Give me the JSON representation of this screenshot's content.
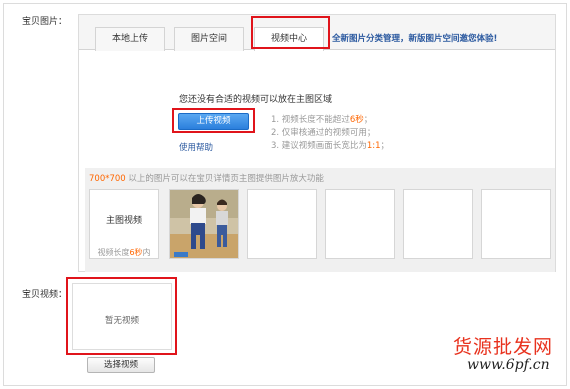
{
  "labels": {
    "images": "宝贝图片：",
    "video": "宝贝视频："
  },
  "tabs": [
    {
      "label": "本地上传",
      "active": false
    },
    {
      "label": "图片空间",
      "active": false
    },
    {
      "label": "视频中心",
      "active": true
    }
  ],
  "promo": {
    "text": "全新图片分类管理，新版图片空间邀您体验",
    "bang": "!"
  },
  "video_center": {
    "message": "您还没有合适的视频可以放在主图区域",
    "upload_button": "上传视频",
    "help_link": "使用帮助",
    "rules": [
      {
        "pre": "1. 视频长度不能超过",
        "hl": "6秒",
        "post": "；"
      },
      {
        "pre": "2. 仅审核通过的视频可用；",
        "hl": "",
        "post": ""
      },
      {
        "pre": "3. 建议视频画面长宽比为",
        "hl": "1:1",
        "post": "；"
      }
    ]
  },
  "gallery": {
    "note_hl": "700*700",
    "note": " 以上的图片可以在宝贝详情页主图提供图片放大功能",
    "main_slot": {
      "title": "主图视频",
      "len_pre": "视频长度",
      "len_hl": "6秒",
      "len_post": "内"
    }
  },
  "video_field": {
    "empty_text": "暂无视频",
    "select_button": "选择视频"
  },
  "watermark": {
    "text": "货源批发网",
    "url": "www.6pf.cn"
  },
  "colors": {
    "accent_red": "#e0141b",
    "link_blue": "#2c5aa0",
    "highlight_orange": "#ff6600",
    "button_blue": "#2b7fdc"
  }
}
